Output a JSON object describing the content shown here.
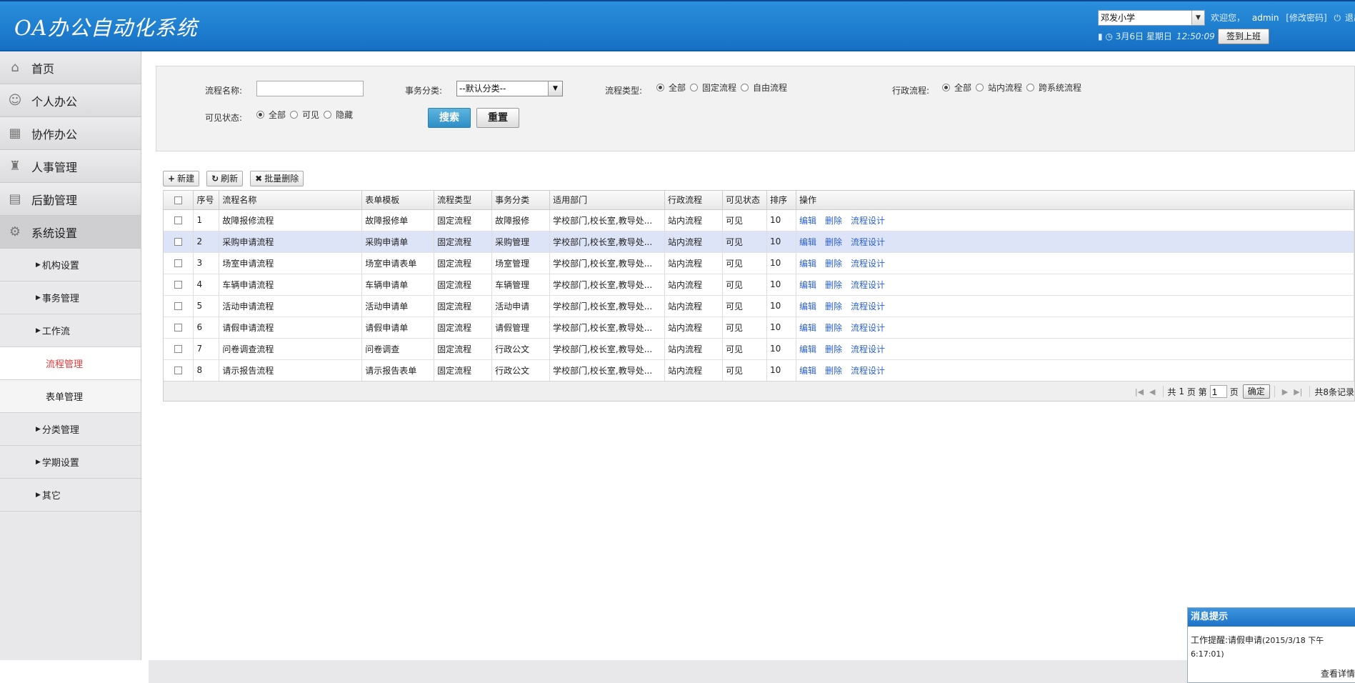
{
  "header": {
    "title": "OA办公自动化系统",
    "school": "邓发小学",
    "welcome": "欢迎您，",
    "user": "admin",
    "change_password": "[修改密码]",
    "logout": "退出",
    "date": "3月6日 星期日",
    "time": "12:50:09",
    "signin": "签到上班"
  },
  "sidebar": {
    "items": [
      {
        "label": "首页",
        "icon": "home-icon"
      },
      {
        "label": "个人办公",
        "icon": "user-icon"
      },
      {
        "label": "协作办公",
        "icon": "cooperation-icon"
      },
      {
        "label": "人事管理",
        "icon": "personnel-icon"
      },
      {
        "label": "后勤管理",
        "icon": "logistics-icon"
      },
      {
        "label": "系统设置",
        "icon": "gear-icon"
      }
    ],
    "sub": [
      "机构设置",
      "事务管理",
      "工作流"
    ],
    "workflow_sub": [
      "流程管理",
      "表单管理"
    ],
    "sub2": [
      "分类管理",
      "学期设置",
      "其它"
    ]
  },
  "search": {
    "flow_name_label": "流程名称:",
    "flow_name_value": "",
    "category_label": "事务分类:",
    "category_value": "--默认分类--",
    "flow_type_label": "流程类型:",
    "flow_type_options": [
      "全部",
      "固定流程",
      "自由流程"
    ],
    "admin_flow_label": "行政流程:",
    "admin_flow_options": [
      "全部",
      "站内流程",
      "跨系统流程"
    ],
    "visibility_label": "可见状态:",
    "visibility_options": [
      "全部",
      "可见",
      "隐藏"
    ],
    "search_btn": "搜索",
    "reset_btn": "重置"
  },
  "toolbar": {
    "new": "新建",
    "refresh": "刷新",
    "batch_delete": "批量删除"
  },
  "table": {
    "columns": [
      "序号",
      "流程名称",
      "表单模板",
      "流程类型",
      "事务分类",
      "适用部门",
      "行政流程",
      "可见状态",
      "排序",
      "操作"
    ],
    "actions": [
      "编辑",
      "删除",
      "流程设计"
    ],
    "rows": [
      [
        "1",
        "故障报修流程",
        "故障报修单",
        "固定流程",
        "故障报修",
        "学校部门,校长室,教导处...",
        "站内流程",
        "可见",
        "10"
      ],
      [
        "2",
        "采购申请流程",
        "采购申请单",
        "固定流程",
        "采购管理",
        "学校部门,校长室,教导处...",
        "站内流程",
        "可见",
        "10"
      ],
      [
        "3",
        "场室申请流程",
        "场室申请表单",
        "固定流程",
        "场室管理",
        "学校部门,校长室,教导处...",
        "站内流程",
        "可见",
        "10"
      ],
      [
        "4",
        "车辆申请流程",
        "车辆申请单",
        "固定流程",
        "车辆管理",
        "学校部门,校长室,教导处...",
        "站内流程",
        "可见",
        "10"
      ],
      [
        "5",
        "活动申请流程",
        "活动申请单",
        "固定流程",
        "活动申请",
        "学校部门,校长室,教导处...",
        "站内流程",
        "可见",
        "10"
      ],
      [
        "6",
        "请假申请流程",
        "请假申请单",
        "固定流程",
        "请假管理",
        "学校部门,校长室,教导处...",
        "站内流程",
        "可见",
        "10"
      ],
      [
        "7",
        "问卷调查流程",
        "问卷调查",
        "固定流程",
        "行政公文",
        "学校部门,校长室,教导处...",
        "站内流程",
        "可见",
        "10"
      ],
      [
        "8",
        "请示报告流程",
        "请示报告表单",
        "固定流程",
        "行政公文",
        "学校部门,校长室,教导处...",
        "站内流程",
        "可见",
        "10"
      ]
    ]
  },
  "pager": {
    "total_pages_pre": "共",
    "total_pages": "1",
    "page_word": "页",
    "current_pre": "第",
    "current": "1",
    "confirm": "确定",
    "total_records": "共8条记录"
  },
  "message": {
    "title": "消息提示",
    "body": "工作提醒:请假申请",
    "time": "(2015/3/18 下午6:17:01)",
    "detail": "查看详情"
  }
}
